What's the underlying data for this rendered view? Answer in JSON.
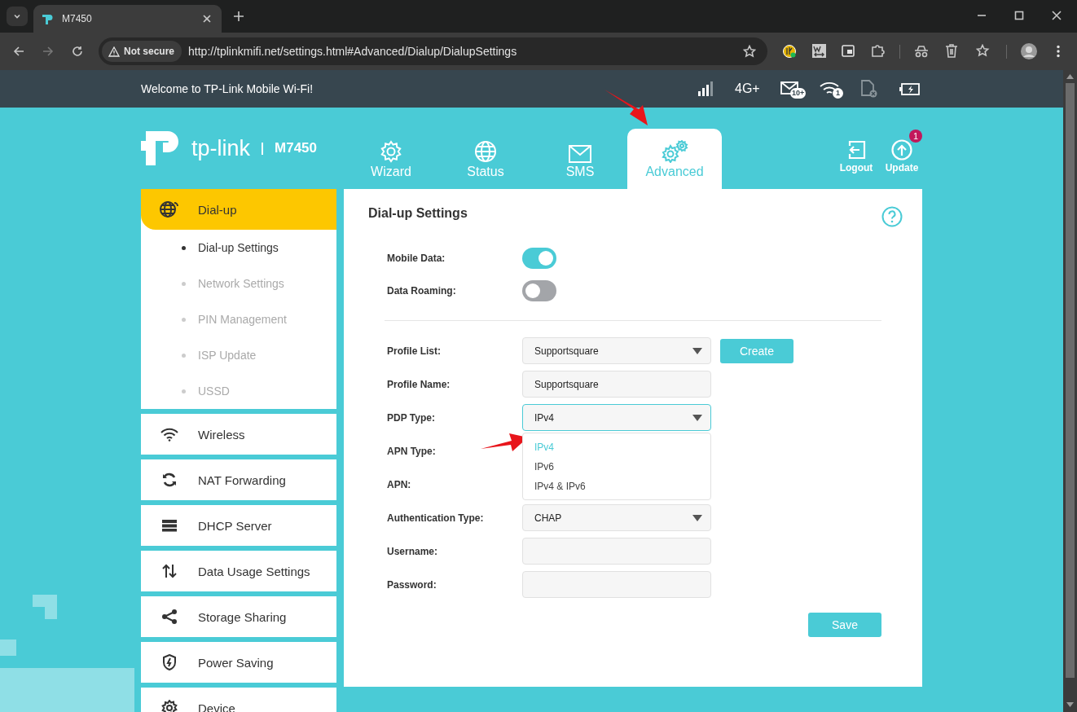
{
  "browser": {
    "tab_title": "M7450",
    "security": "Not secure",
    "url": "http://tplinkmifi.net/settings.html#Advanced/Dialup/DialupSettings"
  },
  "status_bar": {
    "welcome": "Welcome to TP-Link Mobile Wi-Fi!",
    "network": "4G+",
    "messages_badge": "10+",
    "clients_badge": "1"
  },
  "header": {
    "brand": "tp-link",
    "model": "M7450",
    "nav": [
      {
        "label": "Wizard",
        "selected": false
      },
      {
        "label": "Status",
        "selected": false
      },
      {
        "label": "SMS",
        "selected": false
      },
      {
        "label": "Advanced",
        "selected": true
      }
    ],
    "actions": [
      {
        "label": "Logout"
      },
      {
        "label": "Update",
        "badge": "1"
      }
    ]
  },
  "sidebar": {
    "items": [
      {
        "label": "Dial-up",
        "selected": true,
        "children": [
          {
            "label": "Dial-up Settings",
            "selected": true
          },
          {
            "label": "Network Settings",
            "selected": false
          },
          {
            "label": "PIN Management",
            "selected": false
          },
          {
            "label": "ISP Update",
            "selected": false
          },
          {
            "label": "USSD",
            "selected": false
          }
        ]
      },
      {
        "label": "Wireless",
        "selected": false
      },
      {
        "label": "NAT Forwarding",
        "selected": false
      },
      {
        "label": "DHCP Server",
        "selected": false
      },
      {
        "label": "Data Usage Settings",
        "selected": false
      },
      {
        "label": "Storage Sharing",
        "selected": false
      },
      {
        "label": "Power Saving",
        "selected": false
      },
      {
        "label": "Device",
        "selected": false
      }
    ]
  },
  "form": {
    "title": "Dial-up Settings",
    "toggles": [
      {
        "label": "Mobile Data:",
        "on": true
      },
      {
        "label": "Data Roaming:",
        "on": false
      }
    ],
    "rows": [
      {
        "label": "Profile List:",
        "kind": "select",
        "value": "Supportsquare",
        "expanded": false,
        "button": "Create"
      },
      {
        "label": "Profile Name:",
        "kind": "text",
        "value": "Supportsquare"
      },
      {
        "label": "PDP Type:",
        "kind": "select",
        "value": "IPv4",
        "expanded": true,
        "options": [
          {
            "label": "IPv4",
            "selected": true
          },
          {
            "label": "IPv6",
            "selected": false
          },
          {
            "label": "IPv4 & IPv6",
            "selected": false
          }
        ]
      },
      {
        "label": "APN Type:",
        "kind": "covered"
      },
      {
        "label": "APN:",
        "kind": "covered"
      },
      {
        "label": "Authentication Type:",
        "kind": "select",
        "value": "CHAP",
        "expanded": false
      },
      {
        "label": "Username:",
        "kind": "text"
      },
      {
        "label": "Password:",
        "kind": "text"
      }
    ],
    "save": "Save"
  }
}
